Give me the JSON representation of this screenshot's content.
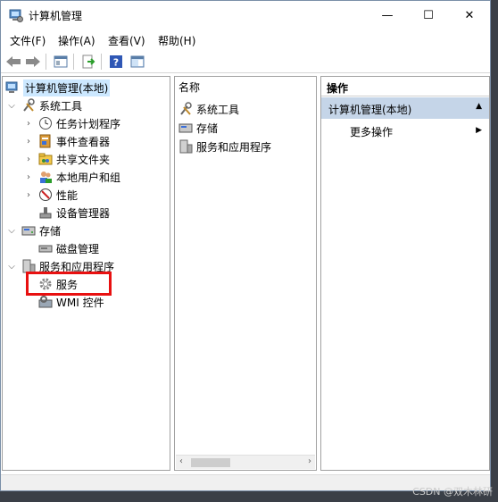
{
  "window": {
    "title": "计算机管理",
    "controls": {
      "minimize": "—",
      "maximize": "☐",
      "close": "✕"
    }
  },
  "menu": [
    "文件(F)",
    "操作(A)",
    "查看(V)",
    "帮助(H)"
  ],
  "tree": {
    "root": "计算机管理(本地)",
    "system_tools": "系统工具",
    "task_scheduler": "任务计划程序",
    "event_viewer": "事件查看器",
    "shared_folders": "共享文件夹",
    "local_users": "本地用户和组",
    "performance": "性能",
    "device_manager": "设备管理器",
    "storage": "存储",
    "disk_management": "磁盘管理",
    "services_apps": "服务和应用程序",
    "services": "服务",
    "wmi": "WMI 控件"
  },
  "center": {
    "column_name": "名称",
    "items": [
      "系统工具",
      "存储",
      "服务和应用程序"
    ]
  },
  "actions": {
    "header": "操作",
    "group": "计算机管理(本地)",
    "more": "更多操作"
  },
  "watermark": "CSDN @双木林研",
  "colors": {
    "highlight_border": "#e81010",
    "selection": "#cce8ff",
    "action_group_bg": "#c5d5e8"
  }
}
